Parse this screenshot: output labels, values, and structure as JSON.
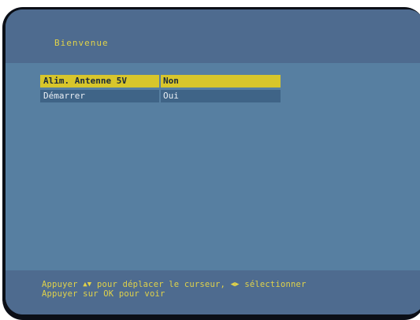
{
  "screen": {
    "title": "Bienvenue"
  },
  "menu": {
    "items": [
      {
        "label": "Alim. Antenne 5V",
        "value": "Non",
        "selected": true
      },
      {
        "label": "Démarrer",
        "value": "Oui",
        "selected": false
      }
    ]
  },
  "footer": {
    "line1_prefix": "Appuyer",
    "line1_updown_icon": "▲▼",
    "line1_middle": "pour déplacer le curseur,",
    "line1_leftright_icon": "◀▶",
    "line1_suffix": "sélectionner",
    "line2": "Appuyer sur OK pour voir"
  },
  "colors": {
    "background": "#577fa1",
    "header_footer": "#4e6b8f",
    "highlight": "#d8c62b",
    "text_yellow": "#e0d24a",
    "row_background": "#3f6487"
  }
}
